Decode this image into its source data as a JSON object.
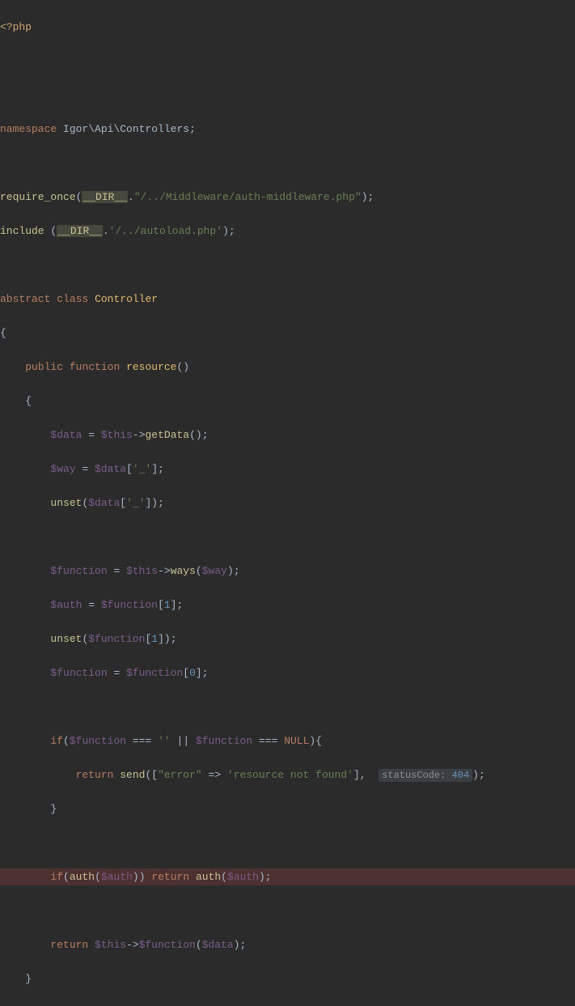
{
  "lines": {
    "l1_php": "<?php",
    "l4_ns_kw": "namespace",
    "l4_ns_path": "Igor\\Api\\Controllers",
    "l6_require": "require_once",
    "l6_magic": "__DIR__",
    "l6_str": "\"/../Middleware/auth-middleware.php\"",
    "l7_include": "include",
    "l7_magic": "__DIR__",
    "l7_str": "'/../autoload.php'",
    "l9_abstract": "abstract",
    "l9_class": "class",
    "l9_name": "Controller",
    "l11_public": "public",
    "l11_function": "function",
    "l11_name": "resource",
    "l13_data": "$data",
    "l13_this": "$this",
    "l13_getData": "getData",
    "l14_way": "$way",
    "l14_data": "$data",
    "l14_key": "'_'",
    "l15_unset": "unset",
    "l15_data": "$data",
    "l15_key": "'_'",
    "l17_function": "$function",
    "l17_this": "$this",
    "l17_ways": "ways",
    "l17_way": "$way",
    "l18_auth": "$auth",
    "l18_function": "$function",
    "l18_num": "1",
    "l19_unset": "unset",
    "l19_function": "$function",
    "l19_num": "1",
    "l20_function_l": "$function",
    "l20_function_r": "$function",
    "l20_num": "0",
    "l22_if": "if",
    "l22_func1": "$function",
    "l22_empty": "''",
    "l22_func2": "$function",
    "l22_null": "NULL",
    "l23_return": "return",
    "l23_send": "send",
    "l23_key": "\"error\"",
    "l23_val": "'resource not found'",
    "l23_hint_label": "statusCode:",
    "l23_hint_val": "404",
    "l26_if": "if",
    "l26_authfn1": "auth",
    "l26_auth1": "$auth",
    "l26_return": "return",
    "l26_authfn2": "auth",
    "l26_auth2": "$auth",
    "l28_return": "return",
    "l28_this": "$this",
    "l28_function": "$function",
    "l28_data": "$data"
  }
}
